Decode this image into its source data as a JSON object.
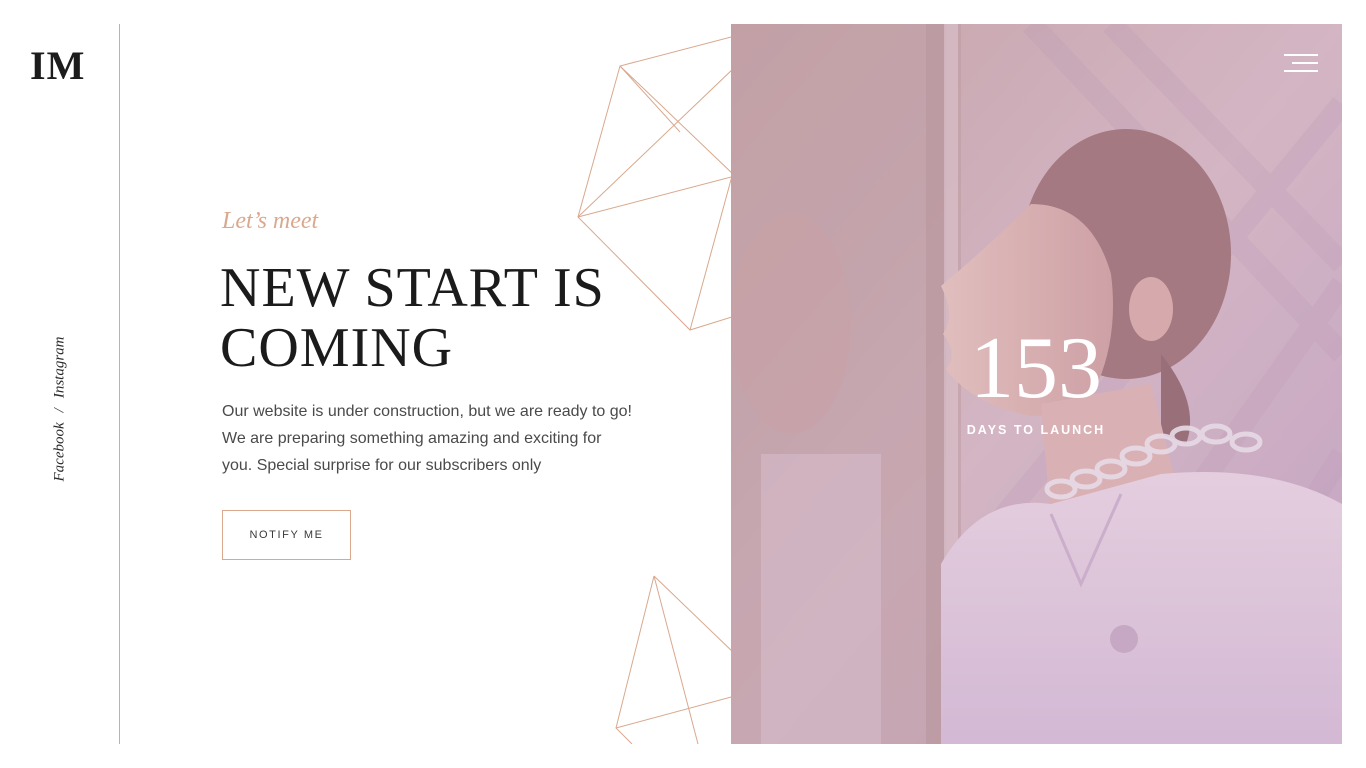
{
  "brand": {
    "logo_text": "IM"
  },
  "social": {
    "facebook": "Facebook",
    "separator": "/",
    "instagram": "Instagram"
  },
  "hero": {
    "kicker": "Let’s meet",
    "headline_line1": "NEW START IS",
    "headline_line2": "COMING",
    "body": "Our website is under construction, but we are ready to go! We are preparing something amazing and exciting for you. Special surprise for our subscribers only",
    "cta_label": "NOTIFY ME"
  },
  "countdown": {
    "value": "153",
    "label": "DAYS TO LAUNCH"
  },
  "colors": {
    "accent": "#d9a88e",
    "text_dark": "#1b1b1b",
    "body_text": "#4a4a4a",
    "photo_tint": "#c8a9c4"
  },
  "icons": {
    "menu": "hamburger-menu-icon"
  }
}
